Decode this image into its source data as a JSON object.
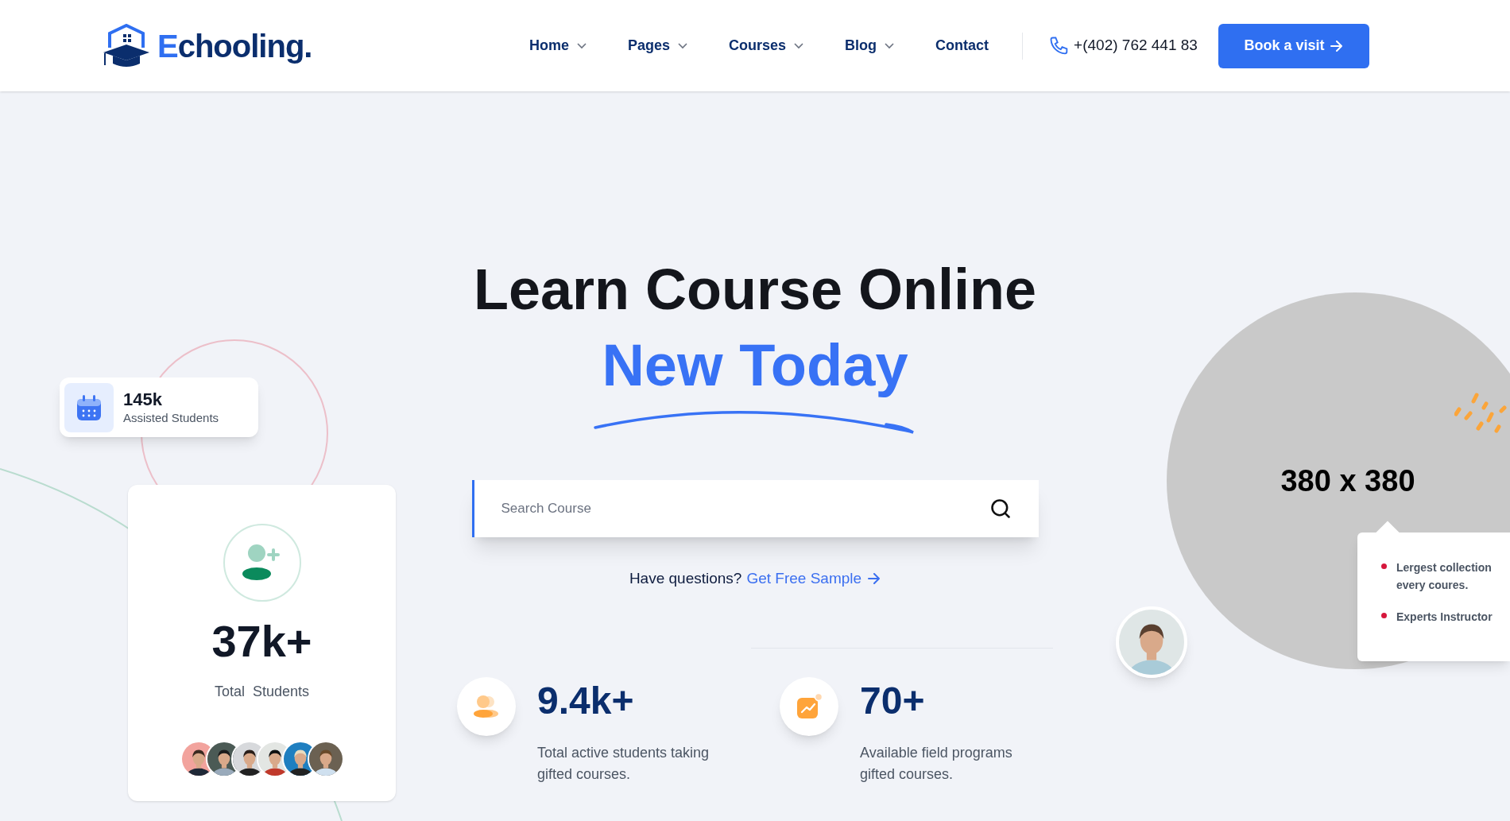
{
  "header": {
    "logo": "Echooling.",
    "nav": [
      {
        "label": "Home",
        "dropdown": true
      },
      {
        "label": "Pages",
        "dropdown": true
      },
      {
        "label": "Courses",
        "dropdown": true
      },
      {
        "label": "Blog",
        "dropdown": true
      },
      {
        "label": "Contact",
        "dropdown": false
      }
    ],
    "phone": "+(402) 762 441 83",
    "button": "Book a visit"
  },
  "hero": {
    "title": "Learn Course Online",
    "highlight": "New Today",
    "search": {
      "placeholder": "Search Course"
    },
    "question": "Have questions?",
    "link": "Get Free Sample"
  },
  "stats": [
    {
      "value": "9.4k+",
      "text": "Total active students taking gifted courses."
    },
    {
      "value": "70+",
      "text": "Available field programs gifted courses."
    }
  ],
  "assisted_card": {
    "value": "145k",
    "label": "Assisted Students"
  },
  "students_card": {
    "value": "37k+",
    "label": "Total  Students"
  },
  "image_placeholder": {
    "label": "380 x 380"
  },
  "feature_card": {
    "items": [
      "Lergest collection every coures.",
      "Experts Instructor"
    ]
  }
}
